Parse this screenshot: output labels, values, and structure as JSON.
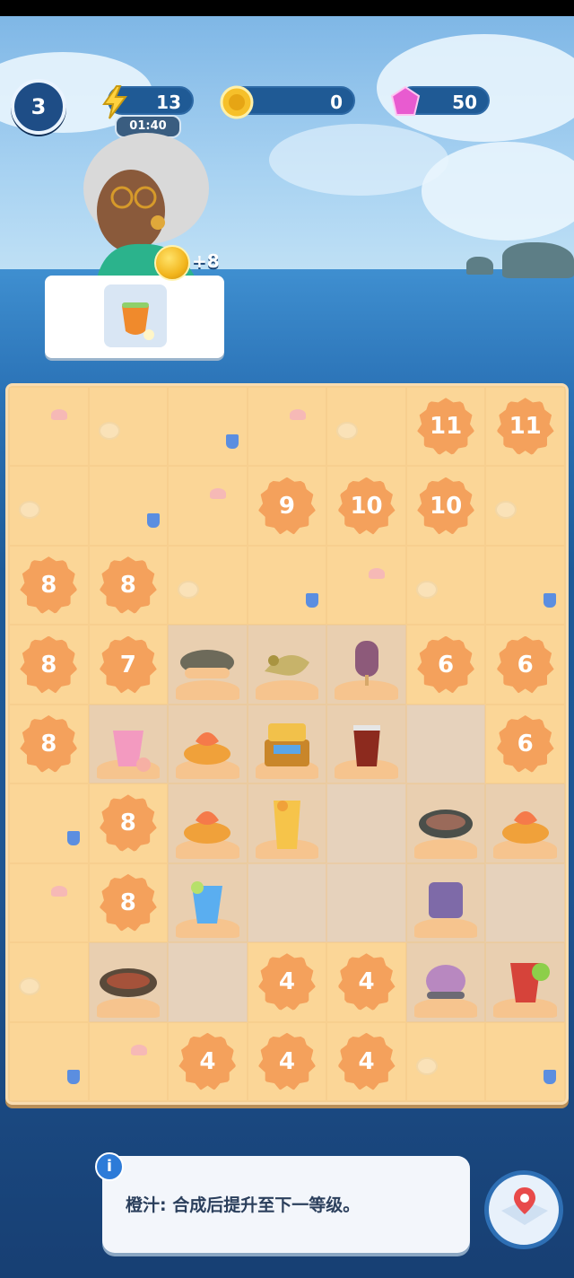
{
  "hud": {
    "level": "3",
    "energy": "13",
    "energy_timer": "01:40",
    "coins": "0",
    "gems": "50"
  },
  "order": {
    "reward": "+8",
    "item_icon": "tropical-cocktail-icon"
  },
  "board": {
    "rows": [
      [
        "sand",
        "sand",
        "sand",
        "sand",
        "sand",
        "11",
        "11"
      ],
      [
        "sand",
        "sand",
        "sand",
        "9",
        "10",
        "10",
        "sand"
      ],
      [
        "8",
        "8",
        "sand",
        "sand",
        "sand",
        "sand",
        "sand"
      ],
      [
        "8",
        "7",
        "grilled-fish",
        "snake-toy",
        "popsicle",
        "6",
        "6"
      ],
      [
        "8",
        "pink-smoothie",
        "shrimp-dish",
        "golden-chest",
        "red-tea",
        "empty",
        "6"
      ],
      [
        "sand",
        "8",
        "shrimp-dish",
        "orange-juice",
        "empty",
        "pot-dish",
        "shrimp-dish"
      ],
      [
        "sand",
        "8",
        "blue-drink",
        "empty",
        "empty",
        "purple-jelly",
        "empty"
      ],
      [
        "sand",
        "stew-pot",
        "empty",
        "4",
        "4",
        "berry-dessert",
        "fruit-cocktail"
      ],
      [
        "sand",
        "sand",
        "4",
        "4",
        "4",
        "sand",
        "sand"
      ]
    ]
  },
  "info": {
    "text": "橙汁: 合成后提升至下一等级。"
  },
  "colors": {
    "accent": "#2e6fb4",
    "board_sand": "#fbd697",
    "lock_badge": "#f4a15c"
  }
}
